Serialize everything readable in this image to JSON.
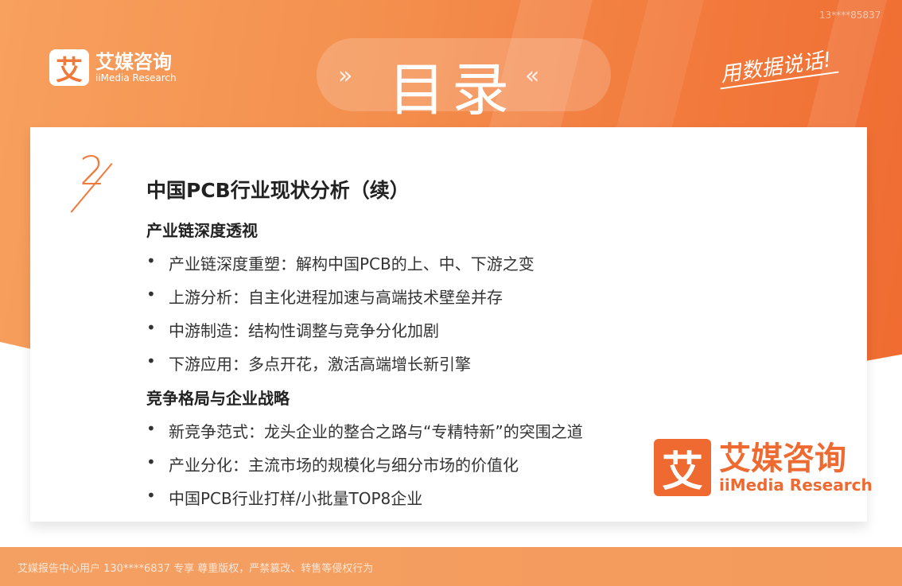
{
  "watermark": "13****85837",
  "logo": {
    "mark": "艾",
    "name": "艾媒咨询",
    "sub": "iiMedia Research"
  },
  "title": "目录",
  "title_chevrons": {
    "left": "»",
    "right": "«"
  },
  "slogan": "用数据说话!",
  "section": {
    "number": "2",
    "title": "中国PCB行业现状分析（续）",
    "groups": [
      {
        "heading": "产业链深度透视",
        "bullets": [
          "产业链深度重塑：解构中国PCB的上、中、下游之变",
          "上游分析：自主化进程加速与高端技术壁垒并存",
          "中游制造：结构性调整与竞争分化加剧",
          "下游应用：多点开花，激活高端增长新引擎"
        ]
      },
      {
        "heading": "竞争格局与企业战略",
        "bullets": [
          "新竞争范式：龙头企业的整合之路与“专精特新”的突围之道",
          "产业分化：主流市场的规模化与细分市场的价值化",
          "中国PCB行业打样/小批量TOP8企业"
        ]
      }
    ]
  },
  "bullet_symbol": "•",
  "big_logo": {
    "mark": "艾",
    "name": "艾媒咨询",
    "sub": "iiMedia Research"
  },
  "footer": "艾媒报告中心用户 130****6837 专享 尊重版权，严禁篡改、转售等侵权行为",
  "colors": {
    "accent": "#ef6a30",
    "text": "#222222"
  }
}
